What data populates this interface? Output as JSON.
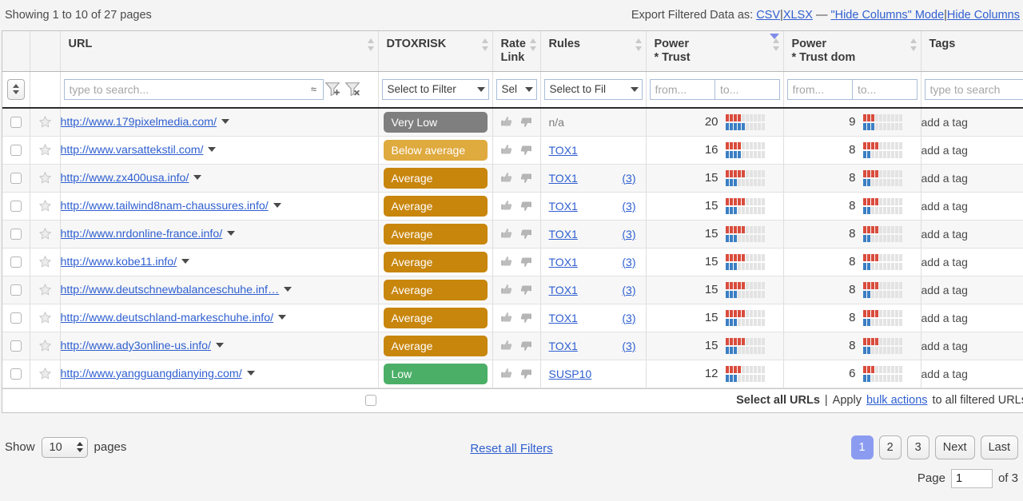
{
  "topbar": {
    "showing": "Showing 1 to 10 of 27 pages",
    "export_label": "Export Filtered Data as:",
    "csv": "CSV",
    "pipe1": "|",
    "xlsx": "XLSX",
    "dash": "—",
    "hide_columns_mode": "\"Hide Columns\" Mode",
    "pipe2": "|",
    "hide_columns": "Hide Columns"
  },
  "table": {
    "headers": {
      "url": "URL",
      "dtoxrisk": "DTOXRISK",
      "rate_link": "Rate\nLink",
      "rate_link_l1": "Rate",
      "rate_link_l2": "Link",
      "rules": "Rules",
      "power_trust_l1": "Power",
      "power_trust_l2": "* Trust",
      "power_trust_dom_l1": "Power",
      "power_trust_dom_l2": "* Trust dom",
      "tags": "Tags"
    },
    "filters": {
      "url_placeholder": "type to search...",
      "regex_glyph": "≈",
      "dtox_select": "Select to Filter",
      "rate_select": "Sel",
      "rules_select": "Select to Fil",
      "from_placeholder": "from...",
      "to_placeholder": "to...",
      "tags_placeholder": "type to search"
    },
    "rows": [
      {
        "url": "http://www.179pixelmedia.com/",
        "dtox": "Very Low",
        "dtox_color": "#7f7f7f",
        "rule": "n/a",
        "rule_is_link": false,
        "rule_count": "",
        "pt_value": "20",
        "pt_red": 4,
        "pt_blue": 5,
        "ptd_value": "9",
        "ptd_red": 3,
        "ptd_blue": 3,
        "tag": "add a tag"
      },
      {
        "url": "http://www.varsattekstil.com/",
        "dtox": "Below average",
        "dtox_color": "#dfaa3e",
        "rule": "TOX1",
        "rule_is_link": true,
        "rule_count": "",
        "pt_value": "16",
        "pt_red": 4,
        "pt_blue": 4,
        "ptd_value": "8",
        "ptd_red": 4,
        "ptd_blue": 2,
        "tag": "add a tag"
      },
      {
        "url": "http://www.zx400usa.info/",
        "dtox": "Average",
        "dtox_color": "#c8860d",
        "rule": "TOX1",
        "rule_is_link": true,
        "rule_count": "(3)",
        "pt_value": "15",
        "pt_red": 5,
        "pt_blue": 3,
        "ptd_value": "8",
        "ptd_red": 4,
        "ptd_blue": 2,
        "tag": "add a tag"
      },
      {
        "url": "http://www.tailwind8nam-chaussures.info/",
        "dtox": "Average",
        "dtox_color": "#c8860d",
        "rule": "TOX1",
        "rule_is_link": true,
        "rule_count": "(3)",
        "pt_value": "15",
        "pt_red": 5,
        "pt_blue": 3,
        "ptd_value": "8",
        "ptd_red": 4,
        "ptd_blue": 2,
        "tag": "add a tag"
      },
      {
        "url": "http://www.nrdonline-france.info/",
        "dtox": "Average",
        "dtox_color": "#c8860d",
        "rule": "TOX1",
        "rule_is_link": true,
        "rule_count": "(3)",
        "pt_value": "15",
        "pt_red": 5,
        "pt_blue": 3,
        "ptd_value": "8",
        "ptd_red": 4,
        "ptd_blue": 2,
        "tag": "add a tag"
      },
      {
        "url": "http://www.kobe11.info/",
        "dtox": "Average",
        "dtox_color": "#c8860d",
        "rule": "TOX1",
        "rule_is_link": true,
        "rule_count": "(3)",
        "pt_value": "15",
        "pt_red": 5,
        "pt_blue": 3,
        "ptd_value": "8",
        "ptd_red": 4,
        "ptd_blue": 2,
        "tag": "add a tag"
      },
      {
        "url": "http://www.deutschnewbalanceschuhe.inf…",
        "dtox": "Average",
        "dtox_color": "#c8860d",
        "rule": "TOX1",
        "rule_is_link": true,
        "rule_count": "(3)",
        "pt_value": "15",
        "pt_red": 5,
        "pt_blue": 3,
        "ptd_value": "8",
        "ptd_red": 4,
        "ptd_blue": 2,
        "tag": "add a tag"
      },
      {
        "url": "http://www.deutschland-markeschuhe.info/",
        "dtox": "Average",
        "dtox_color": "#c8860d",
        "rule": "TOX1",
        "rule_is_link": true,
        "rule_count": "(3)",
        "pt_value": "15",
        "pt_red": 5,
        "pt_blue": 3,
        "ptd_value": "8",
        "ptd_red": 4,
        "ptd_blue": 2,
        "tag": "add a tag"
      },
      {
        "url": "http://www.ady3online-us.info/",
        "dtox": "Average",
        "dtox_color": "#c8860d",
        "rule": "TOX1",
        "rule_is_link": true,
        "rule_count": "(3)",
        "pt_value": "15",
        "pt_red": 5,
        "pt_blue": 3,
        "ptd_value": "8",
        "ptd_red": 4,
        "ptd_blue": 2,
        "tag": "add a tag"
      },
      {
        "url": "http://www.yangguangdianying.com/",
        "dtox": "Low",
        "dtox_color": "#4caf68",
        "rule": "SUSP10",
        "rule_is_link": true,
        "rule_count": "",
        "pt_value": "12",
        "pt_red": 4,
        "pt_blue": 3,
        "ptd_value": "6",
        "ptd_red": 3,
        "ptd_blue": 2,
        "tag": "add a tag"
      }
    ]
  },
  "select_all": {
    "label": "Select all URLs",
    "pipe": "|",
    "apply": "Apply",
    "bulk_actions": "bulk actions",
    "suffix": "to all filtered URLs"
  },
  "bottom": {
    "show_label": "Show",
    "page_size": "10",
    "pages_label": "pages",
    "reset_link": "Reset all Filters",
    "pager": [
      "1",
      "2",
      "3",
      "Next",
      "Last"
    ],
    "page_word": "Page",
    "page_value": "1",
    "of_label": "of 3"
  },
  "colors": {
    "accent_blue": "#2f5fd0",
    "pager_active": "#8b9cf0",
    "bar_red": "#d94c3d",
    "bar_blue": "#3b7fc4",
    "bar_empty": "#e3e3e3"
  }
}
